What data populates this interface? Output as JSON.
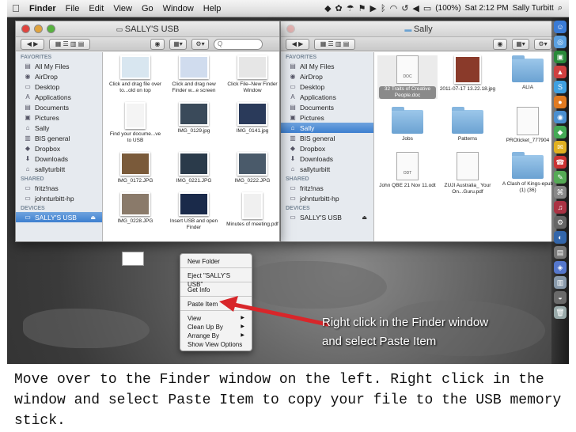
{
  "menubar": {
    "apple": "",
    "items": [
      "Finder",
      "File",
      "Edit",
      "View",
      "Go",
      "Window",
      "Help"
    ],
    "battery": "(100%)",
    "clock": "Sat 2:12 PM",
    "user": "Sally Turbitt"
  },
  "left_window": {
    "title": "SALLY'S USB",
    "search_placeholder": "Q",
    "sidebar": {
      "favorites_header": "FAVORITES",
      "favorites": [
        "All My Files",
        "AirDrop",
        "Desktop",
        "Applications",
        "Documents",
        "Pictures",
        "Sally",
        "BIS general",
        "Dropbox",
        "Downloads",
        "sallyturbitt"
      ],
      "shared_header": "SHARED",
      "shared": [
        "fritz!nas",
        "johnturbitt-hp"
      ],
      "devices_header": "DEVICES",
      "devices": [
        "SALLY'S USB"
      ]
    },
    "files": [
      "Click and drag file over to...old on top",
      "Click and drag new Finder w...e screen",
      "Click File–New Finder Window",
      "Find your docume...ve to USB",
      "IMG_0129.jpg",
      "IMG_0141.jpg",
      "IMG_0172.JPG",
      "IMG_0221.JPG",
      "IMG_0222.JPG",
      "IMG_0228.JPG",
      "Insert USB and open Finder",
      "Minutes of meeting.pdf"
    ]
  },
  "context_menu": {
    "items": [
      "New Folder",
      "Eject \"SALLY'S USB\"",
      "Get Info",
      "Paste Item",
      "View",
      "Clean Up By",
      "Arrange By",
      "Show View Options"
    ]
  },
  "right_window": {
    "title": "Sally",
    "sidebar": {
      "favorites_header": "FAVORITES",
      "favorites": [
        "All My Files",
        "AirDrop",
        "Desktop",
        "Applications",
        "Documents",
        "Pictures",
        "Sally",
        "BIS general",
        "Dropbox",
        "Downloads",
        "sallyturbitt"
      ],
      "shared_header": "SHARED",
      "shared": [
        "fritz!nas",
        "johnturbitt-hp"
      ],
      "devices_header": "DEVICES",
      "devices": [
        "SALLY'S USB"
      ]
    },
    "files": [
      "32 Traits of Creative People.doc",
      "2011-07-17 13.22.18.jpg",
      "ALIA",
      "Jobs",
      "Patterns",
      "PROticket_777904",
      "John QBE 21 Nov 11.odt",
      "ZUJI Australia_ Your On...Guru.pdf",
      "A Clash of Kings-epub (1) (36)"
    ],
    "doc_badge": "DOC",
    "odt_badge": "ODT"
  },
  "callout": {
    "line1": "Right click in the Finder window",
    "line2": "and select Paste Item"
  },
  "caption": "Move over to the Finder window on the left. Right click in the window and select Paste Item to copy your file to the USB memory stick.",
  "colors": {
    "selection": "#3d7fcf",
    "arrow": "#d8262a",
    "folder": "#6ba2d2"
  }
}
